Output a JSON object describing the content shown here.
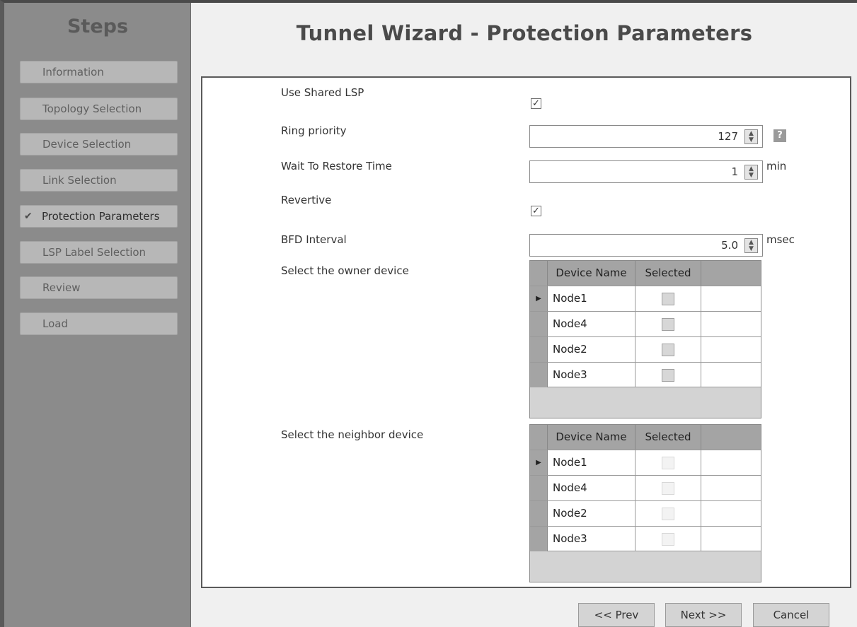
{
  "sidebar": {
    "title": "Steps",
    "steps": [
      {
        "label": "Information",
        "done": false
      },
      {
        "label": "Topology Selection",
        "done": false
      },
      {
        "label": "Device Selection",
        "done": false
      },
      {
        "label": "Link Selection",
        "done": false
      },
      {
        "label": "Protection Parameters",
        "done": true
      },
      {
        "label": "LSP Label Selection",
        "done": false
      },
      {
        "label": "Review",
        "done": false
      },
      {
        "label": "Load",
        "done": false
      }
    ],
    "check_glyph": "✔"
  },
  "main": {
    "title": "Tunnel Wizard - Protection Parameters"
  },
  "form": {
    "use_shared_lsp": {
      "label": "Use Shared LSP",
      "checked": true
    },
    "ring_priority": {
      "label": "Ring priority",
      "value": "127",
      "help": "?"
    },
    "wait_to_restore": {
      "label": "Wait To Restore Time",
      "value": "1",
      "unit": "min"
    },
    "revertive": {
      "label": "Revertive",
      "checked": true
    },
    "bfd_interval": {
      "label": "BFD Interval",
      "value": "5.0",
      "unit": "msec"
    },
    "owner": {
      "label": "Select the owner device",
      "columns": [
        "Device Name",
        "Selected"
      ],
      "rows": [
        {
          "name": "Node1",
          "selected": false,
          "current": true
        },
        {
          "name": "Node4",
          "selected": false
        },
        {
          "name": "Node2",
          "selected": false
        },
        {
          "name": "Node3",
          "selected": false
        }
      ]
    },
    "neighbor": {
      "label": "Select the neighbor device",
      "columns": [
        "Device Name",
        "Selected"
      ],
      "rows": [
        {
          "name": "Node1",
          "selected": false,
          "current": true,
          "disabled": true
        },
        {
          "name": "Node4",
          "selected": false,
          "disabled": true
        },
        {
          "name": "Node2",
          "selected": false,
          "disabled": true
        },
        {
          "name": "Node3",
          "selected": false,
          "disabled": true
        }
      ]
    },
    "check_glyph": "✓",
    "spin_glyph": "⌃⌄",
    "row_pointer_glyph": "▶"
  },
  "footer": {
    "prev_label": "<< Prev",
    "next_label": "Next >>",
    "cancel_label": "Cancel"
  }
}
